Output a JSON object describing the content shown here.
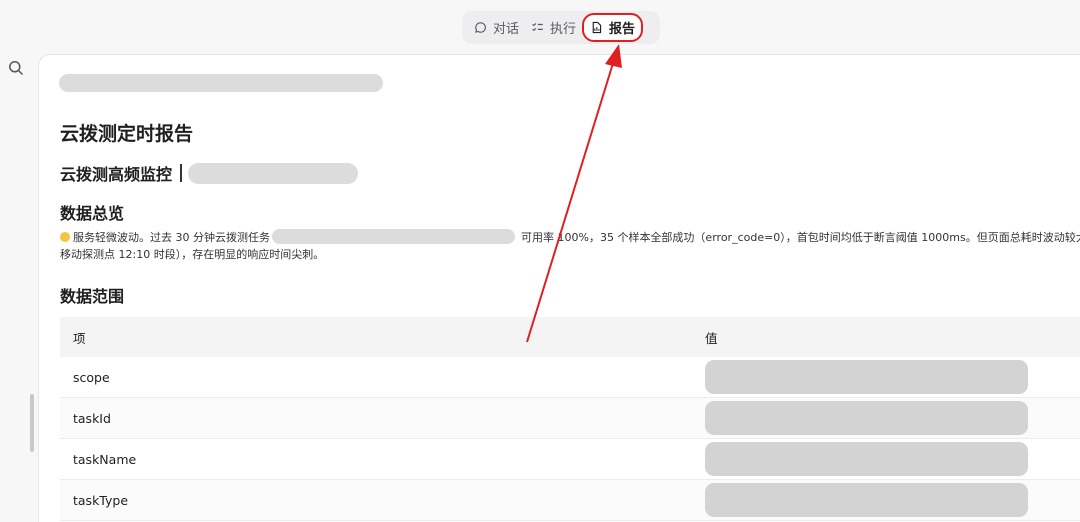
{
  "tabs": [
    {
      "label": "对话",
      "icon": "chat-bubble-icon",
      "active": false
    },
    {
      "label": "执行",
      "icon": "checklist-icon",
      "active": false
    },
    {
      "label": "报告",
      "icon": "report-document-icon",
      "active": true
    }
  ],
  "report": {
    "title": "云拨测定时报告",
    "subtitle": "云拨测高频监控",
    "overview_heading": "数据总览",
    "summary_line1_pre": "服务轻微波动。过去 30 分钟云拨测任务",
    "summary_line1_post": "可用率 100%，35 个样本全部成功（error_code=0），首包时间均低于断言阈值 1000ms。但页面总耗时波动较大，平均",
    "summary_line2": "移动探测点 12:10 时段），存在明显的响应时间尖刺。",
    "range_heading": "数据范围",
    "table": {
      "col_key": "项",
      "col_value": "值",
      "rows": [
        {
          "key": "scope"
        },
        {
          "key": "taskId"
        },
        {
          "key": "taskName"
        },
        {
          "key": "taskType"
        }
      ]
    }
  },
  "colors": {
    "annotation": "#e02020",
    "status_dot": "#f5c542"
  }
}
